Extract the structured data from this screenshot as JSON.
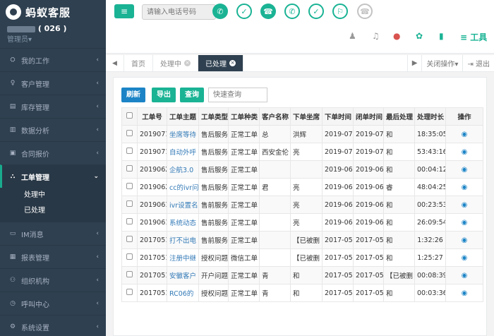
{
  "brand": {
    "name": "蚂蚁客服"
  },
  "user": {
    "name_suffix": " ( 026 )",
    "role": "管理员▾"
  },
  "sidebar": {
    "items": [
      {
        "icon": "⛭",
        "label": "我的工作",
        "chev": "‹"
      },
      {
        "icon": "♀",
        "label": "客户管理",
        "chev": "‹"
      },
      {
        "icon": "▤",
        "label": "库存管理",
        "chev": "‹"
      },
      {
        "icon": "▥",
        "label": "数据分析",
        "chev": "‹"
      },
      {
        "icon": "▣",
        "label": "合同报价",
        "chev": "‹"
      },
      {
        "icon": "⛬",
        "label": "工单管理",
        "chev": "⌄"
      },
      {
        "icon": "▭",
        "label": "IM消息",
        "chev": "‹"
      },
      {
        "icon": "▦",
        "label": "报表管理",
        "chev": "‹"
      },
      {
        "icon": "⚇",
        "label": "组织机构",
        "chev": "‹"
      },
      {
        "icon": "◷",
        "label": "呼叫中心",
        "chev": "‹"
      },
      {
        "icon": "⚙",
        "label": "系统设置",
        "chev": "‹"
      }
    ],
    "sub_items": [
      "处理中",
      "已处理"
    ]
  },
  "topbar": {
    "menu_icon": "≡",
    "phone_placeholder": "请输入电话号码",
    "call_icons": [
      "✆",
      "✓",
      "☎",
      "✆",
      "✓",
      "⚐",
      "☎"
    ],
    "tool_label": "工具"
  },
  "tabs": {
    "prev": "◀",
    "next": "▶",
    "home": "首页",
    "processing": "处理中",
    "processed": "已处理",
    "close_ops": "关闭操作▾",
    "logout": "⇥ 退出"
  },
  "toolbar": {
    "refresh": "刷新",
    "export": "导出",
    "query": "查询",
    "search_placeholder": "快速查询"
  },
  "table": {
    "headers": [
      "工单号",
      "工单主题",
      "工单类型",
      "工单种类",
      "客户名称",
      "下单坐席",
      "下单时间",
      "闭单时间",
      "最后处理",
      "处理时长",
      "操作"
    ],
    "rows": [
      [
        "2019071",
        "坐席等待",
        "售后服务",
        "正常工单",
        "总",
        "洪辉",
        "2019-07-",
        "2019-07-",
        "和",
        "18:35:05"
      ],
      [
        "2019071",
        "自动外呼",
        "售后服务",
        "正常工单",
        "西安金伦",
        "亮",
        "2019-07-",
        "2019-07-",
        "和",
        "53:43:16"
      ],
      [
        "2019062",
        "企航3.0",
        "售后服务",
        "正常工单",
        "",
        "",
        "2019-06-",
        "2019-06-",
        "和",
        "00:04:12"
      ],
      [
        "2019062",
        "cc的ivr问",
        "售后服务",
        "正常工单",
        "君",
        "亮",
        "2019-06-",
        "2019-06-",
        "睿",
        "48:04:25"
      ],
      [
        "2019061",
        "ivr设置名",
        "售前服务",
        "正常工单",
        "",
        "亮",
        "2019-06-",
        "2019-06-",
        "和",
        "00:23:53"
      ],
      [
        "2019061",
        "系统动态",
        "售前服务",
        "正常工单",
        "",
        "亮",
        "2019-06-",
        "2019-06-",
        "和",
        "26:09:54"
      ],
      [
        "2017051",
        "打不出电",
        "售前服务",
        "正常工单",
        "",
        "【已被删",
        "2017-05-",
        "2017-05-",
        "和",
        "1:32:26"
      ],
      [
        "2017051",
        "注册中继",
        "授权问题",
        "微信工单",
        "",
        "【已被删",
        "2017-05-",
        "2017-05-",
        "和",
        "1:25:27"
      ],
      [
        "2017051",
        "安徽客户",
        "开户问题",
        "正常工单",
        "青",
        "和",
        "2017-05-",
        "2017-05-",
        "【已被删",
        "00:08:39"
      ],
      [
        "2017051",
        "RC06的",
        "授权问题",
        "正常工单",
        "青",
        "和",
        "2017-05-",
        "2017-05-",
        "和",
        "00:03:36"
      ]
    ]
  },
  "colors": {
    "sidebar": "#2f4050",
    "accent": "#1ab394",
    "primary": "#1c84c6"
  }
}
